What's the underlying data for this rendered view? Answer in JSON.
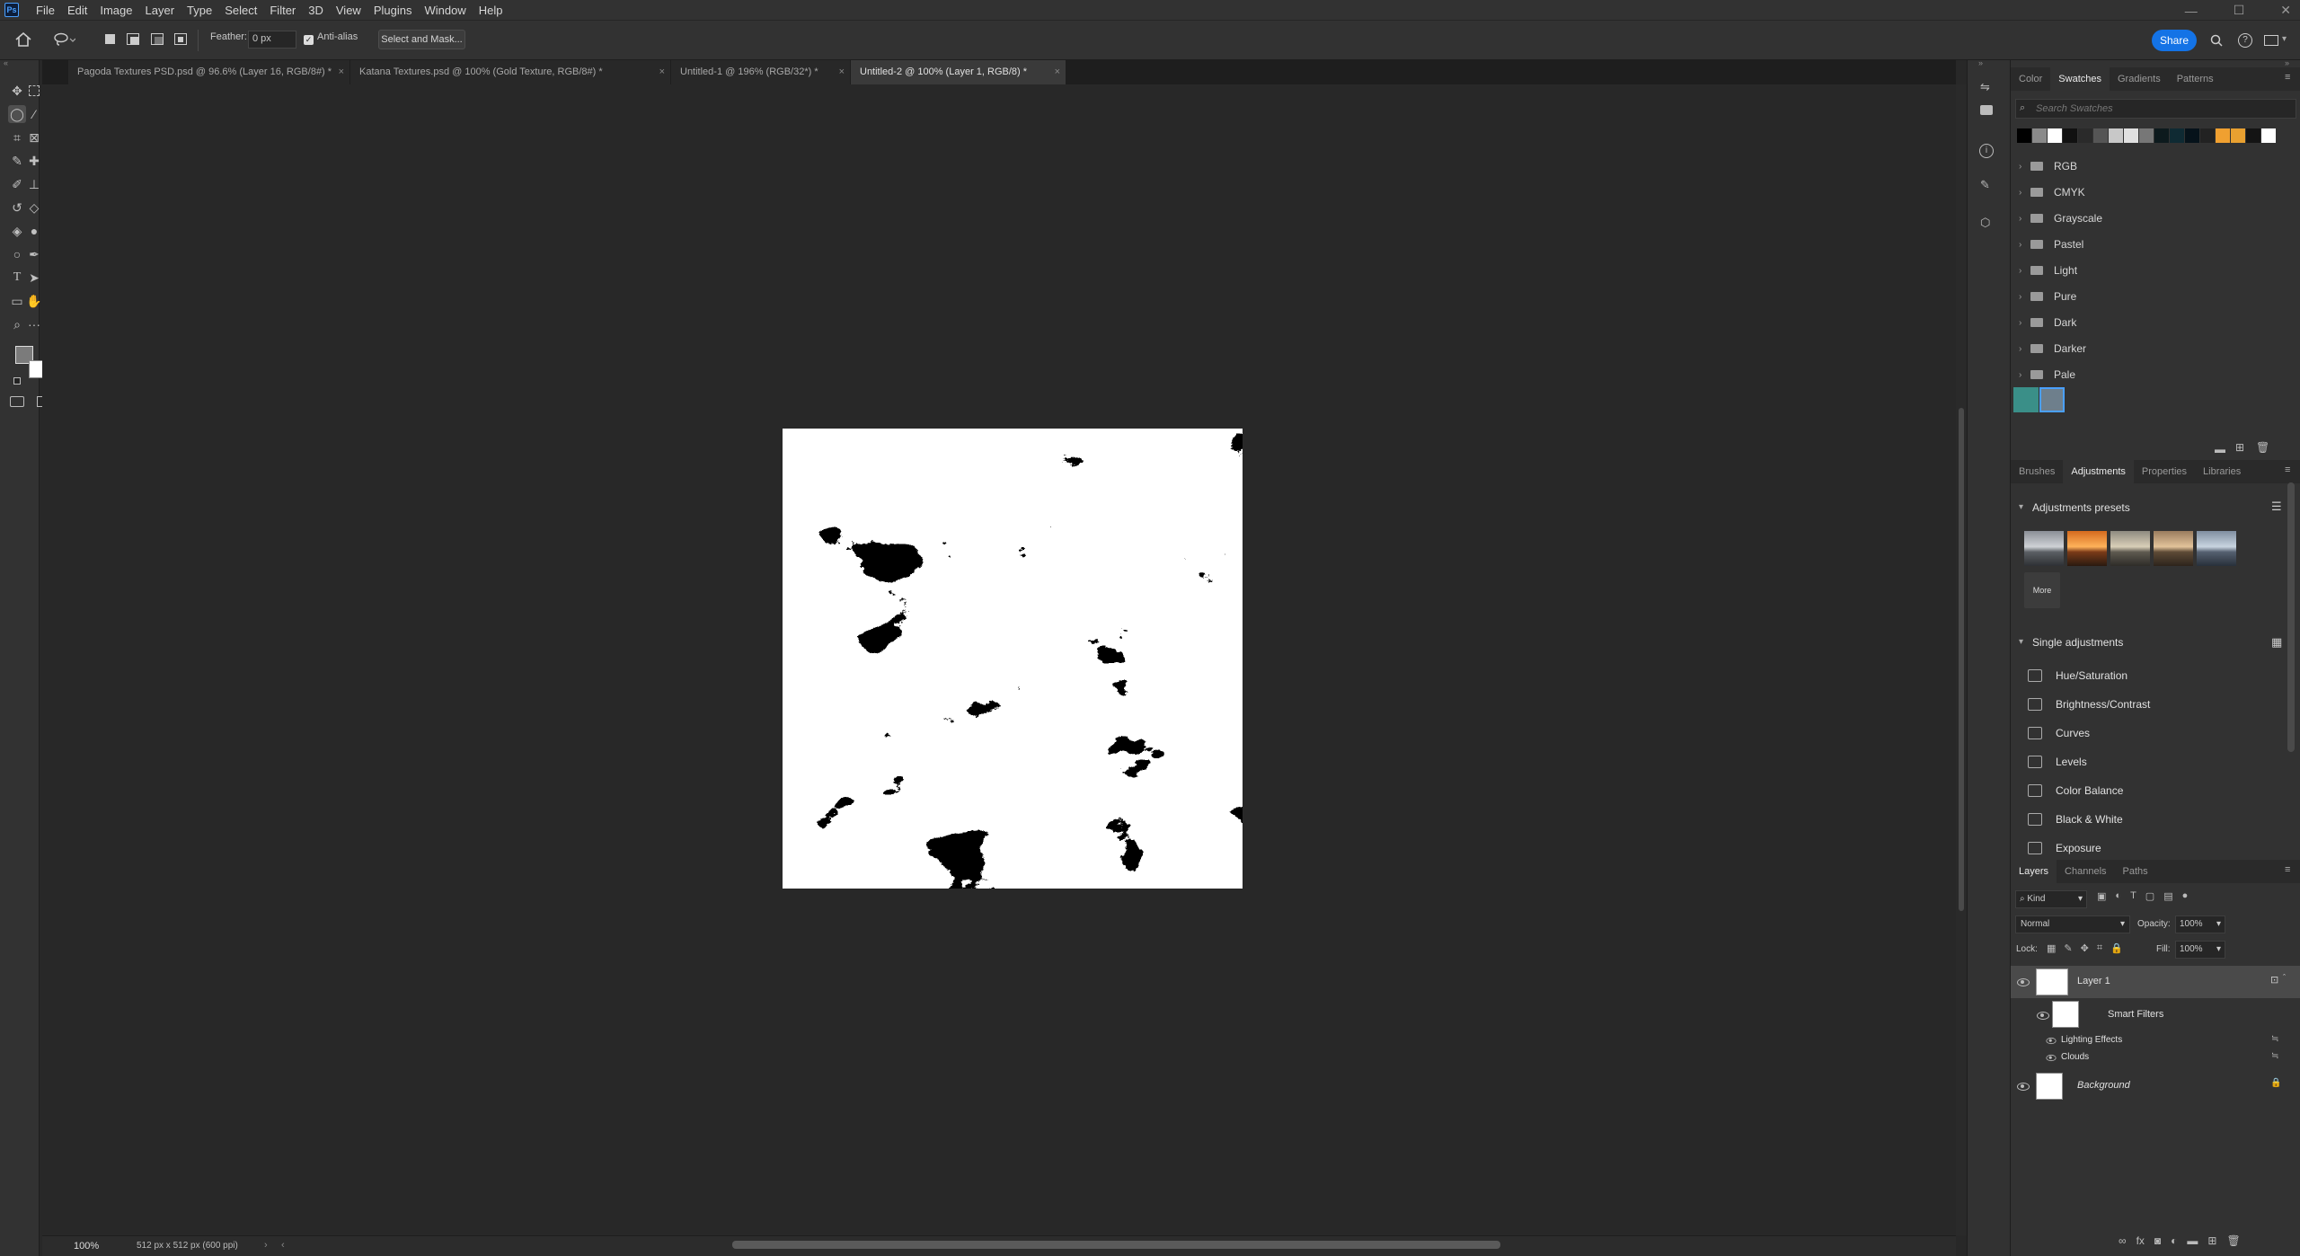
{
  "app": {
    "logo": "Ps",
    "accent": "#1473e6"
  },
  "menu": [
    "File",
    "Edit",
    "Image",
    "Layer",
    "Type",
    "Select",
    "Filter",
    "3D",
    "View",
    "Plugins",
    "Window",
    "Help"
  ],
  "window_controls": [
    "—",
    "☐",
    "✕"
  ],
  "options": {
    "feather_label": "Feather:",
    "feather_value": "0 px",
    "antialias_label": "Anti-alias",
    "antialias_checked": true,
    "select_mask_label": "Select and Mask...",
    "share_label": "Share"
  },
  "tabs": [
    {
      "label": "Pagoda Textures PSD.psd @ 96.6% (Layer 16, RGB/8#) *",
      "active": false
    },
    {
      "label": "Katana Textures.psd @ 100% (Gold Texture, RGB/8#) *",
      "active": false
    },
    {
      "label": "Untitled-1 @ 196% (RGB/32*) *",
      "active": false
    },
    {
      "label": "Untitled-2 @ 100% (Layer 1, RGB/8) *",
      "active": true
    }
  ],
  "status": {
    "zoom": "100%",
    "doc_info": "512 px x 512 px (600 ppi)"
  },
  "swatches_panel": {
    "tabs": [
      "Color",
      "Swatches",
      "Gradients",
      "Patterns"
    ],
    "active_tab": "Swatches",
    "search_placeholder": "Search Swatches",
    "recent_colors": [
      "#000000",
      "#8a8a8a",
      "#ffffff",
      "#111111",
      "#2a2a2a",
      "#555555",
      "#c8c8c8",
      "#e0e0e0",
      "#777777",
      "#0d1a1d",
      "#0f2a33",
      "#06121a",
      "#222222",
      "#f0a030",
      "#e8a030",
      "#141414",
      "#ffffff"
    ],
    "folders": [
      "RGB",
      "CMYK",
      "Grayscale",
      "Pastel",
      "Light",
      "Pure",
      "Dark",
      "Darker",
      "Pale"
    ],
    "custom_swatches": [
      "#3a8f88",
      "#6e7f8c"
    ]
  },
  "adjustments_panel": {
    "tabs": [
      "Brushes",
      "Adjustments",
      "Properties",
      "Libraries"
    ],
    "active_tab": "Adjustments",
    "presets_title": "Adjustments presets",
    "more_label": "More",
    "single_title": "Single adjustments",
    "items": [
      "Hue/Saturation",
      "Brightness/Contrast",
      "Curves",
      "Levels",
      "Color Balance",
      "Black & White",
      "Exposure"
    ]
  },
  "layers_panel": {
    "tabs": [
      "Layers",
      "Channels",
      "Paths"
    ],
    "active_tab": "Layers",
    "kind_label": "Kind",
    "blend_mode": "Normal",
    "opacity_label": "Opacity:",
    "opacity_value": "100%",
    "lock_label": "Lock:",
    "fill_label": "Fill:",
    "fill_value": "100%",
    "layers": {
      "layer1": "Layer 1",
      "smart_filters": "Smart Filters",
      "filter1": "Lighting Effects",
      "filter2": "Clouds",
      "background": "Background"
    }
  }
}
